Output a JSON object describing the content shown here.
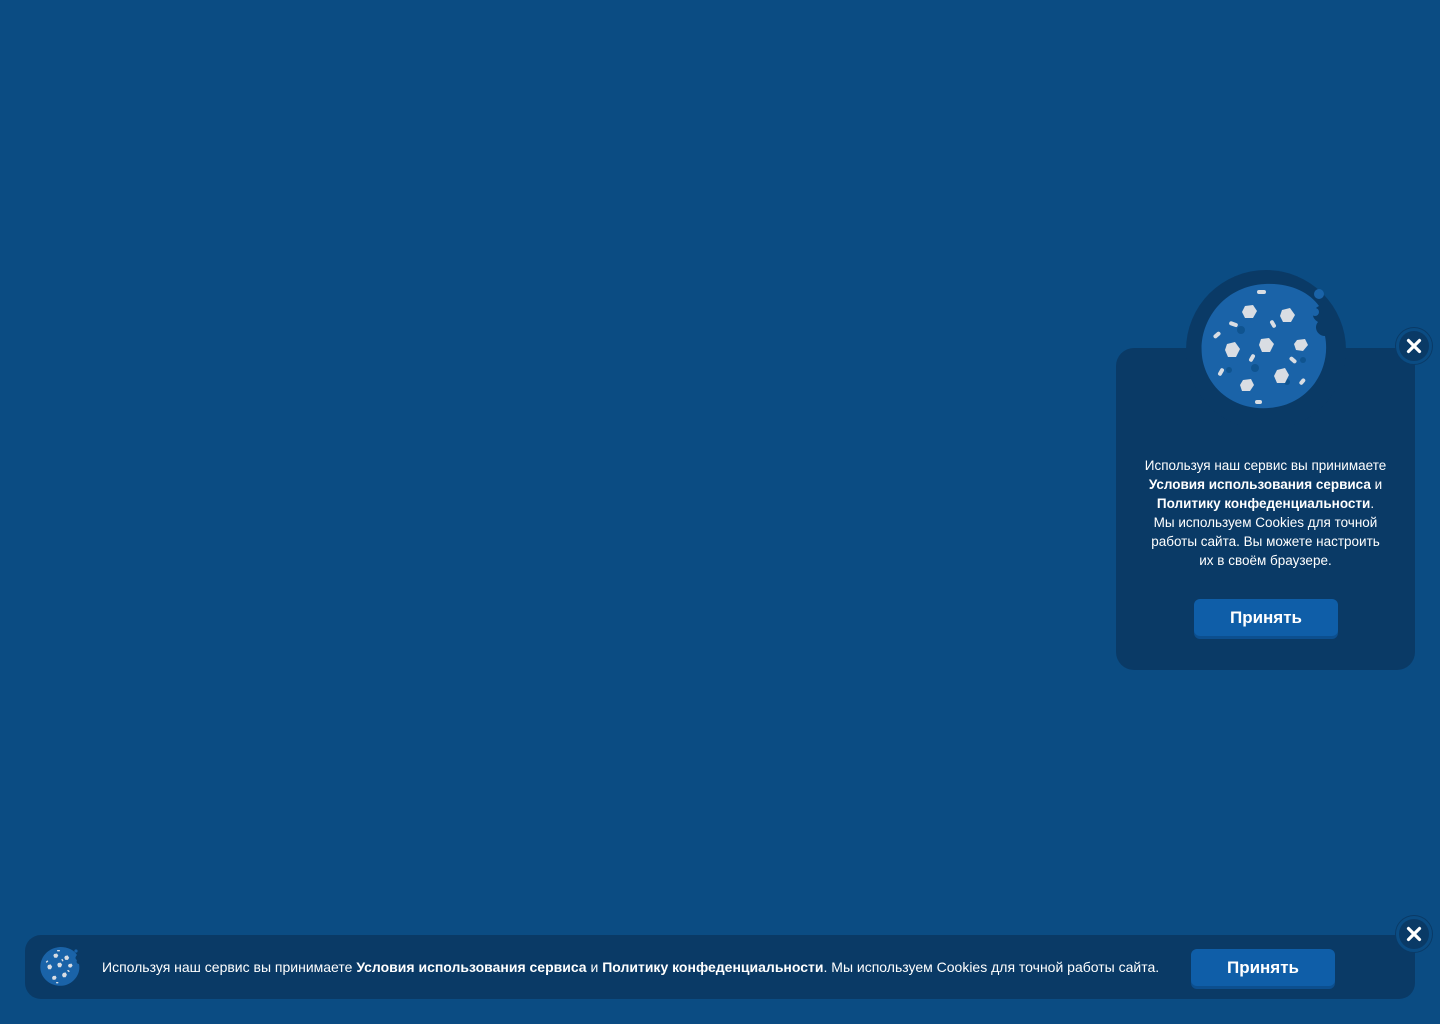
{
  "colors": {
    "background": "#0b4c83",
    "panel": "#0a3a66",
    "button": "#0f5ea8",
    "cookie": "#1a63a8",
    "crumb": "#d9dde3"
  },
  "popup": {
    "icon": "cookie-icon",
    "text_intro": "Используя наш сервис вы принимаете",
    "terms_link": "Условия использования сервиса",
    "and_word": "и",
    "privacy_link": "Политику конфеденциальности",
    "period": ".",
    "cookies_note": "Мы используем Cookies для точной работы сайта. Вы можете настроить их в своём браузере.",
    "accept_label": "Принять",
    "close_icon": "close-icon"
  },
  "bar": {
    "icon": "cookie-icon",
    "text_intro": "Используя наш сервис вы принимаете",
    "terms_link": "Условия использования сервиса",
    "and_word": "и",
    "privacy_link": "Политику конфеденциальности",
    "cookies_note": ". Мы используем Cookies для точной работы сайта.",
    "accept_label": "Принять",
    "close_icon": "close-icon"
  }
}
